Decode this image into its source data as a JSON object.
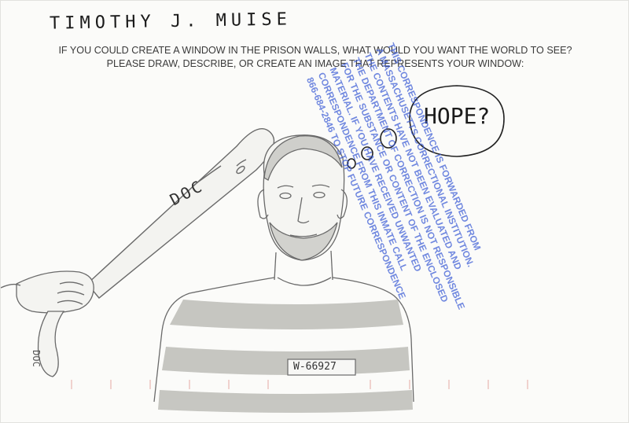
{
  "signature": "TIMOTHY J. MUISE",
  "prompt": {
    "line1": "IF YOU COULD CREATE A WINDOW IN THE PRISON WALLS, WHAT WOULD YOU WANT THE WORLD TO SEE?",
    "line2": "PLEASE DRAW, DESCRIBE, OR CREATE AN IMAGE THAT REPRESENTS YOUR WINDOW:"
  },
  "drawing": {
    "bat_text": "DOC",
    "strap_text": "DOC",
    "thought_bubble": "HOPE?",
    "prison_number": "W-66927"
  },
  "stamp": {
    "lines": [
      "THIS CORRESPONDENCE IS FORWARDED FROM",
      "A MASSACHUSETTS CORRECTIONAL INSTITUTION.",
      "THE CONTENTS HAVE NOT BEEN EVALUATED AND",
      "THE DEPARTMENT OF CORRECTION IS NOT RESPONSIBLE",
      "FOR THE SUBSTANCE OR CONTENT OF THE ENCLOSED",
      "MATERIAL. IF YOU HAVE RECEIVED UNWANTED",
      "CORRESPONDENCE FROM THIS INMATE CALL",
      "866-684-2846 TO STOP FUTURE CORRESPONDENCE"
    ]
  },
  "colors": {
    "pencil": "#555555",
    "ink": "#1b1b1b",
    "stamp": "#3c5cd6"
  }
}
